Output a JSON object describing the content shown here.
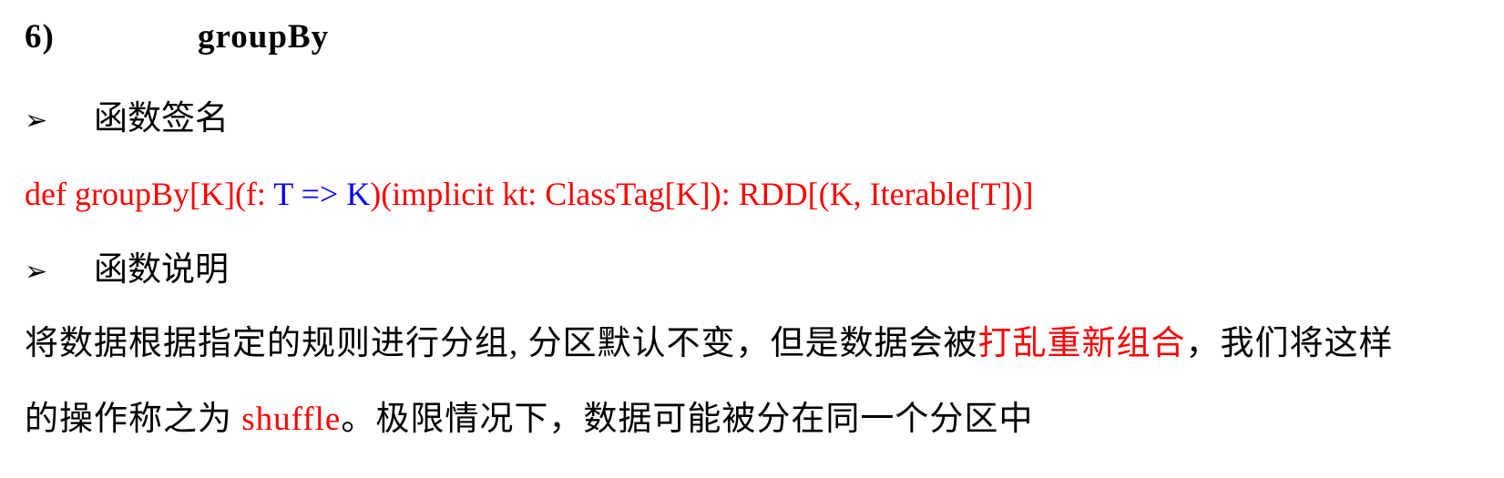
{
  "section": {
    "number": "6)",
    "title": "groupBy"
  },
  "bullets": [
    {
      "icon": "arrow-bullet-icon",
      "arrow": "➢",
      "label": "函数签名"
    },
    {
      "icon": "arrow-bullet-icon",
      "arrow": "➢",
      "label": "函数说明"
    }
  ],
  "signature": {
    "part1": "def groupBy[K](f: ",
    "part2": "T => K",
    "part3": ")(implicit kt: ClassTag[K]): RDD[(K, Iterable[T])]"
  },
  "description": {
    "line1_a": "将数据根据指定的规则进行分组, 分区默认不变，但是数据会被",
    "line1_b": "打乱重新组合",
    "line1_c": "，我们将这样",
    "line2_a": "的操作称之为 ",
    "line2_b": "shuffle",
    "line2_c": "。极限情况下，数据可能被分在同一个分区中"
  },
  "colors": {
    "highlight_red": "#ff0000",
    "highlight_blue": "#0000ff",
    "text": "#000000"
  }
}
